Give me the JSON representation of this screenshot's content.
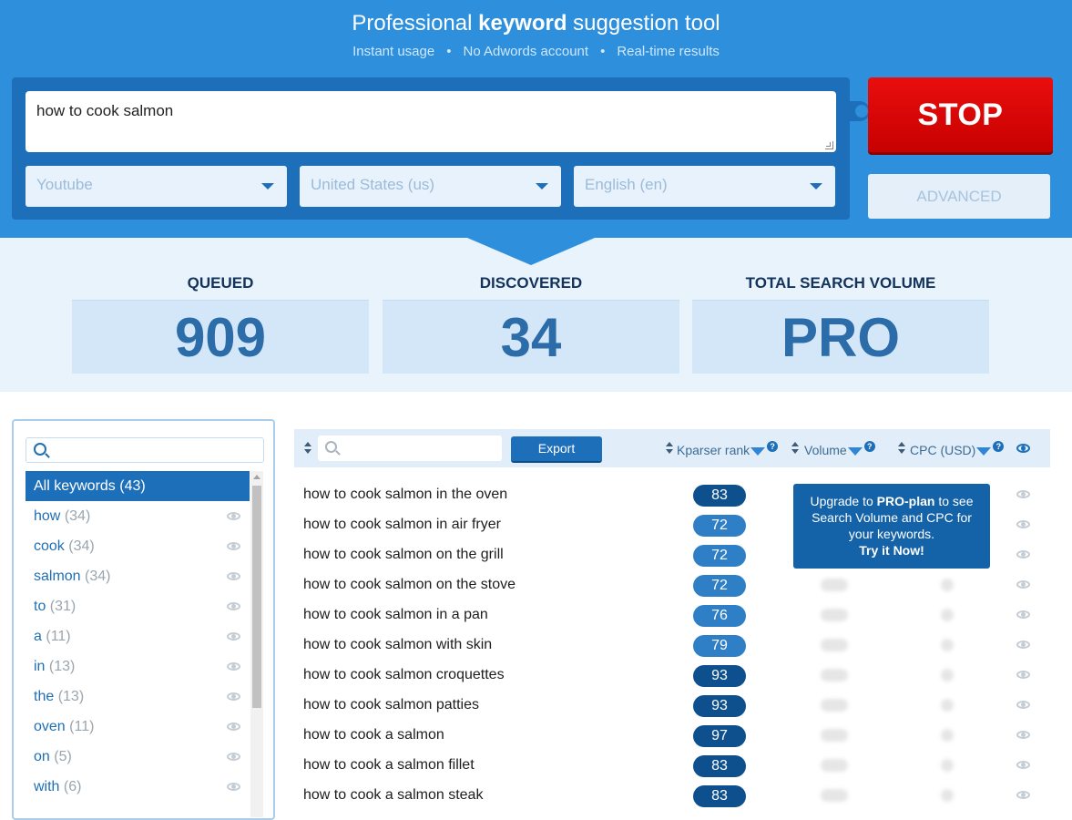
{
  "header": {
    "title_pre": "Professional ",
    "title_bold": "keyword",
    "title_post": " suggestion tool",
    "features": [
      "Instant usage",
      "No Adwords account",
      "Real-time results"
    ],
    "separator": "•"
  },
  "search": {
    "query": "how to cook salmon",
    "source": "Youtube",
    "country": "United States (us)",
    "language": "English (en)",
    "stop_label": "STOP",
    "advanced_label": "ADVANCED"
  },
  "stats": [
    {
      "label": "QUEUED",
      "value": "909"
    },
    {
      "label": "DISCOVERED",
      "value": "34"
    },
    {
      "label": "TOTAL SEARCH VOLUME",
      "value": "PRO"
    }
  ],
  "filter": {
    "search_placeholder": "",
    "items": [
      {
        "label": "All keywords",
        "count": "(43)"
      },
      {
        "label": "how",
        "count": "(34)"
      },
      {
        "label": "cook",
        "count": "(34)"
      },
      {
        "label": "salmon",
        "count": "(34)"
      },
      {
        "label": "to",
        "count": "(31)"
      },
      {
        "label": "a",
        "count": "(11)"
      },
      {
        "label": "in",
        "count": "(13)"
      },
      {
        "label": "the",
        "count": "(13)"
      },
      {
        "label": "oven",
        "count": "(11)"
      },
      {
        "label": "on",
        "count": "(5)"
      },
      {
        "label": "with",
        "count": "(6)"
      }
    ]
  },
  "table": {
    "export_label": "Export",
    "columns": {
      "rank": "Kparser rank",
      "volume": "Volume",
      "cpc": "CPC (USD)",
      "help": "?"
    },
    "rows": [
      {
        "keyword": "how to cook salmon in the oven",
        "rank": "83"
      },
      {
        "keyword": "how to cook salmon in air fryer",
        "rank": "72"
      },
      {
        "keyword": "how to cook salmon on the grill",
        "rank": "72"
      },
      {
        "keyword": "how to cook salmon on the stove",
        "rank": "72"
      },
      {
        "keyword": "how to cook salmon in a pan",
        "rank": "76"
      },
      {
        "keyword": "how to cook salmon with skin",
        "rank": "79"
      },
      {
        "keyword": "how to cook salmon croquettes",
        "rank": "93"
      },
      {
        "keyword": "how to cook salmon patties",
        "rank": "93"
      },
      {
        "keyword": "how to cook a salmon",
        "rank": "97"
      },
      {
        "keyword": "how to cook a salmon fillet",
        "rank": "83"
      },
      {
        "keyword": "how to cook a salmon steak",
        "rank": "83"
      }
    ]
  },
  "pro_popup": {
    "line1_pre": "Upgrade to ",
    "line1_bold": "PRO-plan",
    "line1_post": " to see Search Volume and CPC for your keywords.",
    "cta": "Try it Now!"
  },
  "colors": {
    "brand_blue": "#2e8fdd",
    "dark_blue": "#1c6fb8",
    "stop_red": "#e00808",
    "rank_low": "#2f7fc7",
    "rank_high": "#0e4f8d"
  }
}
